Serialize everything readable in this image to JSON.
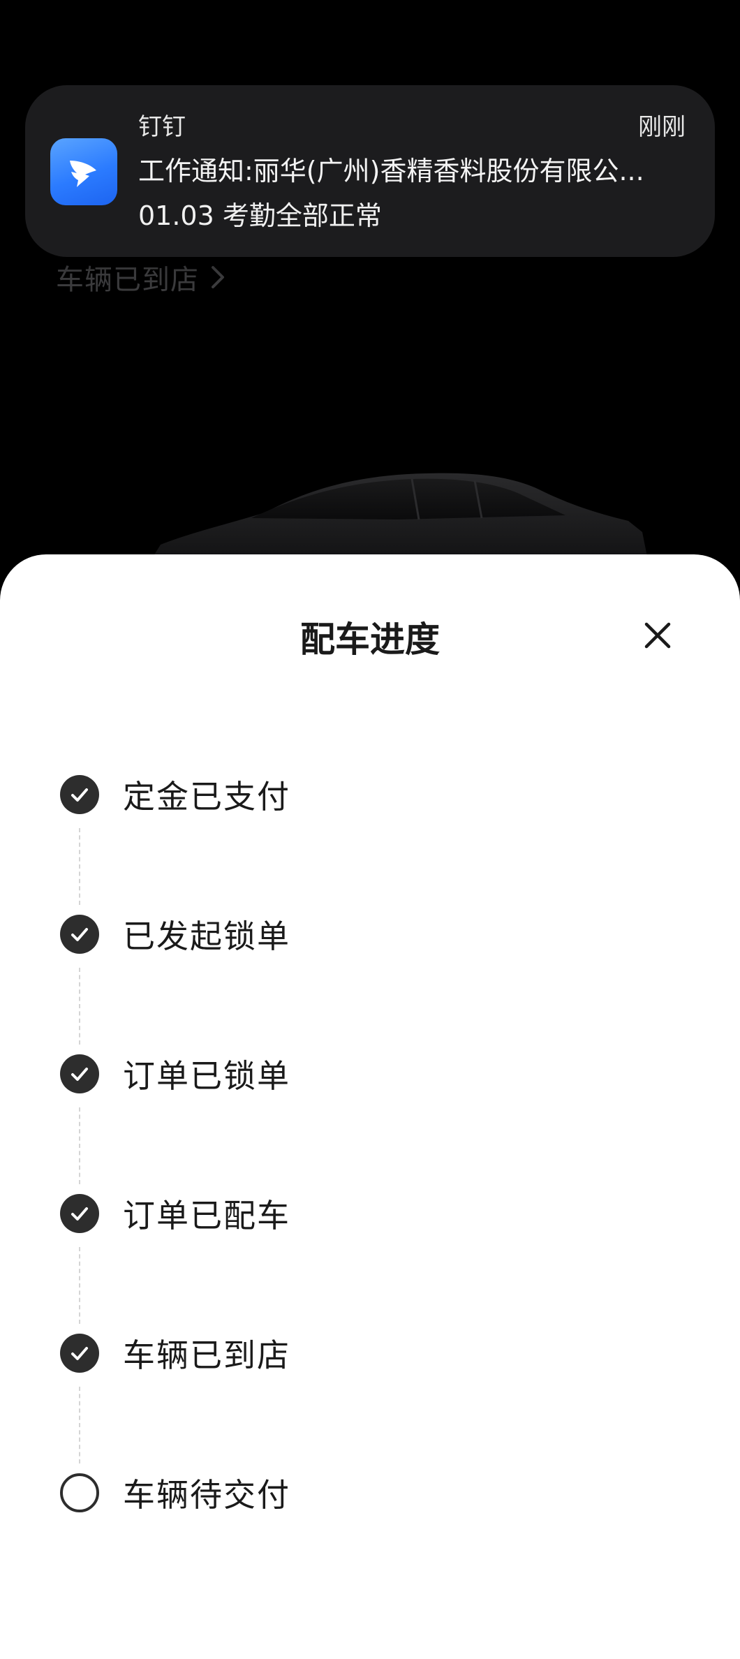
{
  "background": {
    "status_link": "车辆已到店"
  },
  "notification": {
    "app_name": "钉钉",
    "time": "刚刚",
    "title": "工作通知:丽华(广州)香精香料股份有限公...",
    "body": "01.03 考勤全部正常",
    "icon": "dingtalk-icon"
  },
  "sheet": {
    "title": "配车进度",
    "close_icon": "close-icon",
    "steps": [
      {
        "label": "定金已支付",
        "status": "done"
      },
      {
        "label": "已发起锁单",
        "status": "done"
      },
      {
        "label": "订单已锁单",
        "status": "done"
      },
      {
        "label": "订单已配车",
        "status": "done"
      },
      {
        "label": "车辆已到店",
        "status": "done"
      },
      {
        "label": "车辆待交付",
        "status": "pending"
      }
    ]
  },
  "colors": {
    "sheet_bg": "#ffffff",
    "step_done": "#2d2d2d",
    "connector": "#d4d4d4",
    "notification_bg": "#1c1c1e",
    "app_icon": "#2b7bff"
  }
}
